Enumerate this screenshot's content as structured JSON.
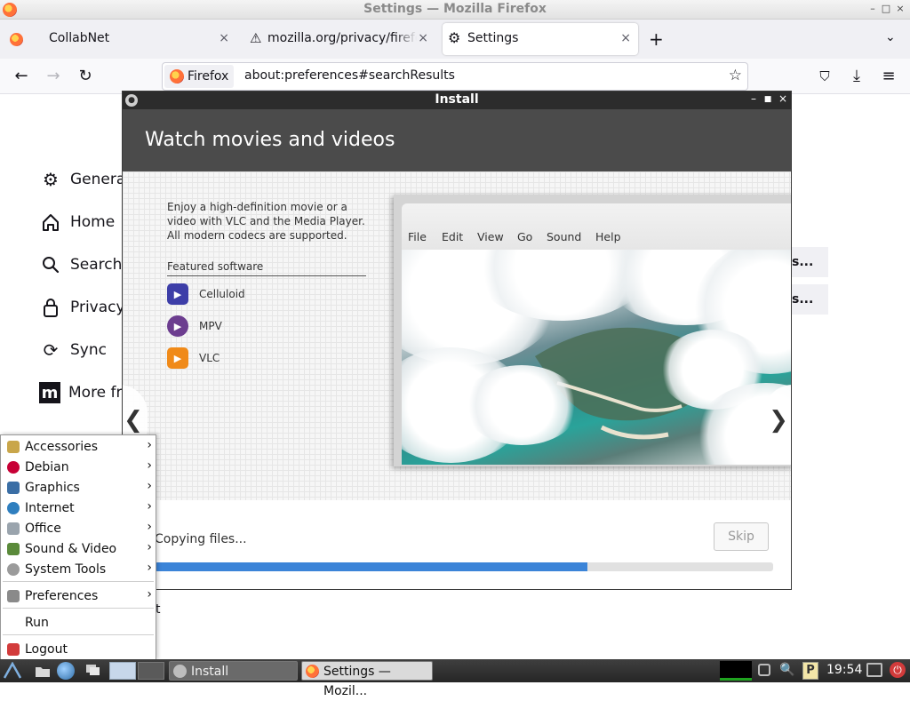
{
  "window": {
    "title": "Settings — Mozilla Firefox",
    "controls": [
      "–",
      "□",
      "×"
    ]
  },
  "tabs": [
    {
      "label": "CollabNet",
      "icon": "firefox-icon",
      "active": false
    },
    {
      "label": "mozilla.org/privacy/firefo",
      "icon": "warning-icon",
      "active": false
    },
    {
      "label": "Settings",
      "icon": "gear-icon",
      "active": true
    }
  ],
  "tab_close": "×",
  "new_tab": "+",
  "list_tabs": "⌄",
  "nav": {
    "back": "←",
    "forward": "→",
    "reload": "↻",
    "identity_label": "Firefox",
    "url": "about:preferences#searchResults",
    "bookmark": "☆",
    "pocket": "⛉",
    "downloads": "⤓",
    "menu": "≡"
  },
  "settings_sidebar": [
    {
      "label": "Genera",
      "icon": "gear-icon"
    },
    {
      "label": "Home",
      "icon": "home-icon"
    },
    {
      "label": "Search",
      "icon": "search-icon"
    },
    {
      "label": "Privacy",
      "icon": "lock-icon"
    },
    {
      "label": "Sync",
      "icon": "sync-icon"
    },
    {
      "label": "More fr",
      "icon": "mozilla-icon"
    }
  ],
  "search_results": [
    "s...",
    "s..."
  ],
  "hidden_text_fragment": "t",
  "install_dialog": {
    "title": "Install",
    "heading": "Watch movies and videos",
    "description": "Enjoy a high-definition movie or a video with VLC and the Media Player. All modern codecs are supported.",
    "featured_label": "Featured software",
    "software": [
      {
        "name": "Celluloid",
        "color": "#3d3ea8"
      },
      {
        "name": "MPV",
        "color": "#6c3d8f"
      },
      {
        "name": "VLC",
        "color": "#f08a19"
      }
    ],
    "screenshot_menu": [
      "File",
      "Edit",
      "View",
      "Go",
      "Sound",
      "Help"
    ],
    "prev_arrow": "❮",
    "next_arrow": "❯",
    "status": "Copying files...",
    "skip_label": "Skip",
    "progress": 0.7
  },
  "start_menu": {
    "items": [
      {
        "label": "Accessories",
        "icon": "accessories-icon",
        "submenu": true,
        "color": "#c9a64a"
      },
      {
        "label": "Debian",
        "icon": "debian-icon",
        "submenu": true,
        "color": "#c70036"
      },
      {
        "label": "Graphics",
        "icon": "graphics-icon",
        "submenu": true,
        "color": "#3a6ea5"
      },
      {
        "label": "Internet",
        "icon": "internet-icon",
        "submenu": true,
        "color": "#2f7fbf"
      },
      {
        "label": "Office",
        "icon": "office-icon",
        "submenu": true,
        "color": "#9aa4ad"
      },
      {
        "label": "Sound & Video",
        "icon": "sound-video-icon",
        "submenu": true,
        "color": "#5a8a3a"
      },
      {
        "label": "System Tools",
        "icon": "system-tools-icon",
        "submenu": true,
        "color": "#9b9b9b"
      },
      {
        "label": "Preferences",
        "icon": "preferences-icon",
        "submenu": true,
        "color": "#8a8a8a"
      },
      {
        "label": "Run",
        "icon": "",
        "submenu": false,
        "color": ""
      },
      {
        "label": "Logout",
        "icon": "logout-icon",
        "submenu": false,
        "color": "#d23b3b"
      }
    ],
    "arrow": "›"
  },
  "taskbar": {
    "tasks": [
      {
        "label": "Install",
        "icon": "installer-icon"
      },
      {
        "label": "Settings — Mozil...",
        "icon": "firefox-icon"
      }
    ],
    "clock": "19:54"
  },
  "colors": {
    "accent": "#3b84d8",
    "dialog_header": "#4b4b4b",
    "panel": "#2b2b2b"
  }
}
